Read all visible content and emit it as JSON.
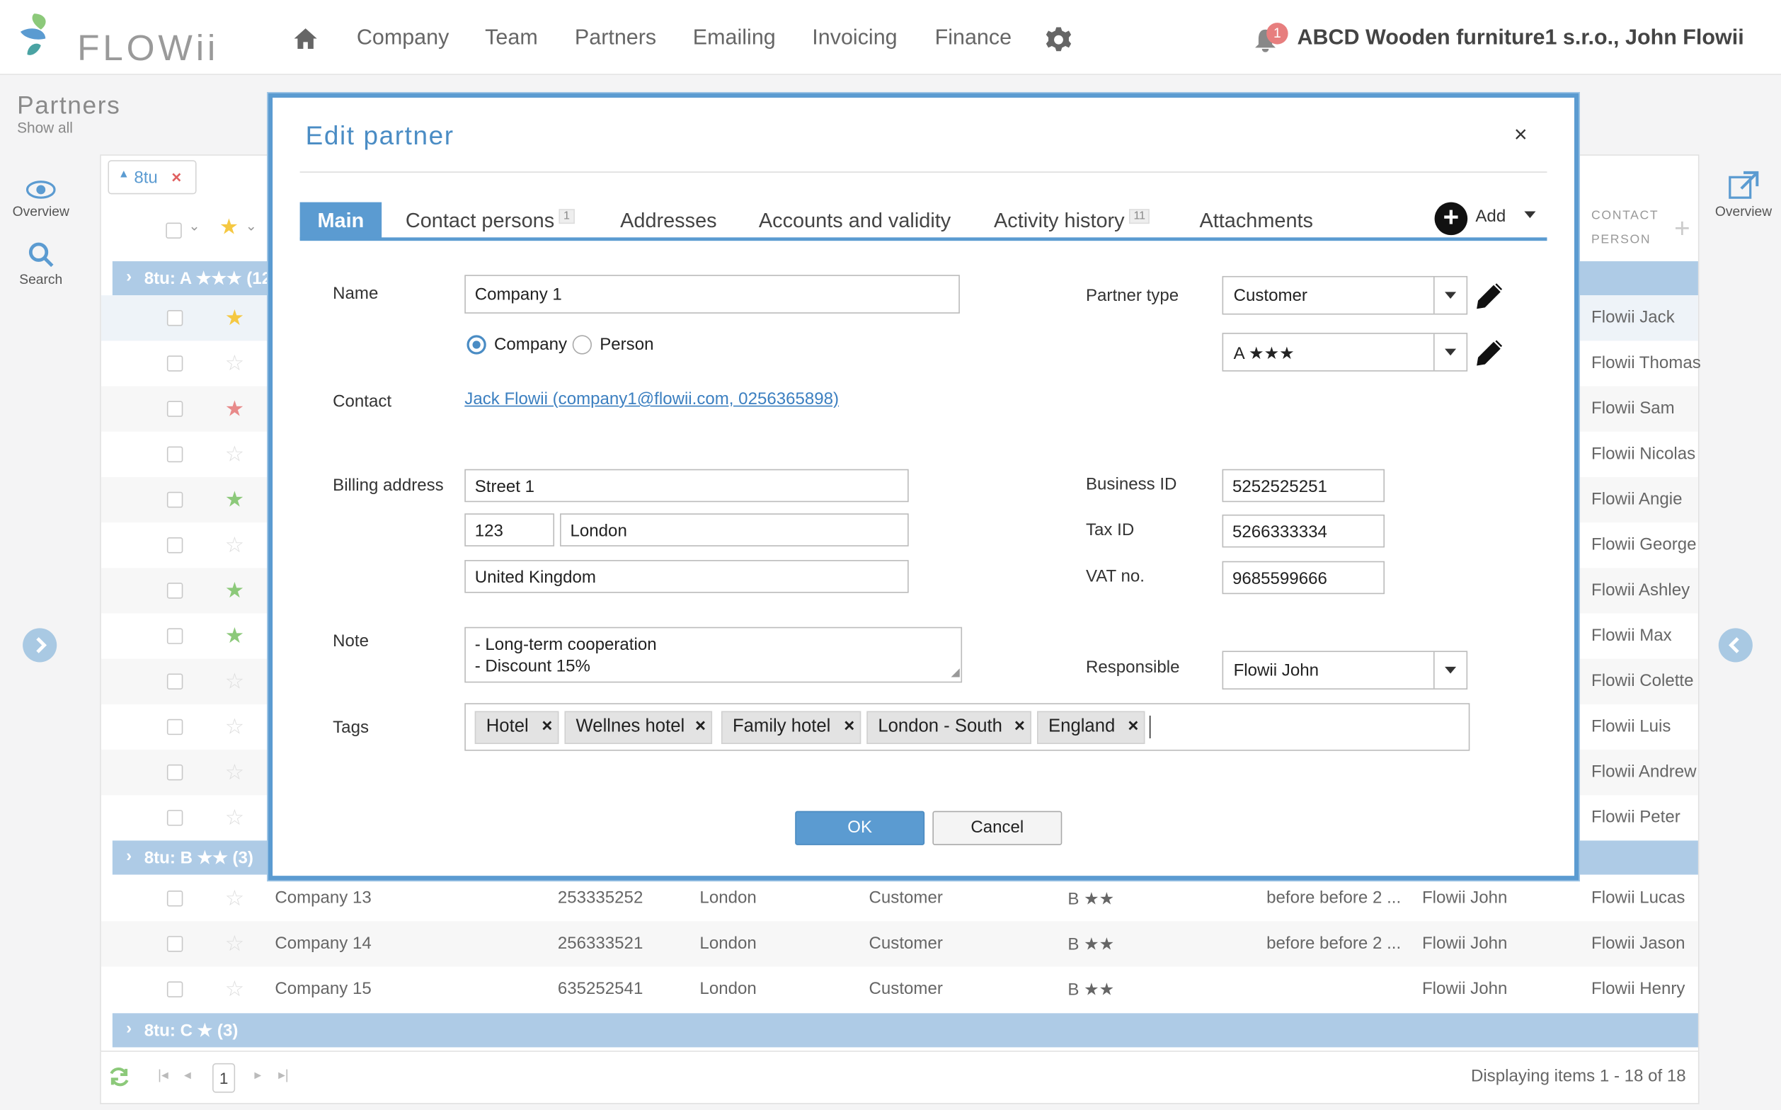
{
  "header": {
    "logo": "FLOWii",
    "nav": [
      "Company",
      "Team",
      "Partners",
      "Emailing",
      "Invoicing",
      "Finance"
    ],
    "notifications": "1",
    "user": "ABCD Wooden furniture1 s.r.o., John Flowii"
  },
  "page": {
    "title": "Partners",
    "subtitle": "Show all"
  },
  "leftbar": {
    "overview": "Overview",
    "search": "Search"
  },
  "rightbar": {
    "overview": "Overview"
  },
  "filter": {
    "chip": "8tu"
  },
  "grid": {
    "contact_header_1": "CONTACT",
    "contact_header_2": "PERSON",
    "group_a": "8tu: A ★★★ (12",
    "group_b": "8tu: B ★★ (3)",
    "group_c": "8tu: C ★ (3)",
    "rows_a": [
      {
        "contact": "Flowii Jack"
      },
      {
        "contact": "Flowii Thomas"
      },
      {
        "contact": "Flowii Sam"
      },
      {
        "contact": "Flowii Nicolas"
      },
      {
        "contact": "Flowii Angie"
      },
      {
        "contact": "Flowii George"
      },
      {
        "contact": "Flowii Ashley"
      },
      {
        "contact": "Flowii Max"
      },
      {
        "contact": "Flowii Colette"
      },
      {
        "contact": "Flowii Luis"
      },
      {
        "contact": "Flowii Andrew"
      },
      {
        "contact": "Flowii Peter"
      }
    ],
    "rows_b": [
      {
        "name": "Company 13",
        "id": "253335252",
        "city": "London",
        "type": "Customer",
        "rating": "B ★★",
        "note": "before before 2 ...",
        "resp": "Flowii John",
        "contact": "Flowii Lucas"
      },
      {
        "name": "Company 14",
        "id": "256333521",
        "city": "London",
        "type": "Customer",
        "rating": "B ★★",
        "note": "before before 2 ...",
        "resp": "Flowii John",
        "contact": "Flowii Jason"
      },
      {
        "name": "Company 15",
        "id": "635252541",
        "city": "London",
        "type": "Customer",
        "rating": "B ★★",
        "note": "",
        "resp": "Flowii John",
        "contact": "Flowii Henry"
      }
    ],
    "page_number": "1",
    "status": "Displaying items 1 - 18 of 18"
  },
  "modal": {
    "title": "Edit partner",
    "close": "×",
    "tabs": {
      "main": "Main",
      "contacts": "Contact persons",
      "contacts_badge": "1",
      "addresses": "Addresses",
      "accounts": "Accounts and validity",
      "activity": "Activity history",
      "activity_badge": "11",
      "attachments": "Attachments",
      "add": "Add"
    },
    "labels": {
      "name": "Name",
      "contact": "Contact",
      "billing": "Billing address",
      "note": "Note",
      "tags": "Tags",
      "partner_type": "Partner type",
      "business_id": "Business ID",
      "tax_id": "Tax ID",
      "vat": "VAT no.",
      "responsible": "Responsible"
    },
    "values": {
      "name": "Company 1",
      "radio_company": "Company",
      "radio_person": "Person",
      "contact_link": "Jack Flowii (company1@flowii.com, 0256365898)",
      "street": "Street 1",
      "zip": "123",
      "city": "London",
      "country": "United Kingdom",
      "note_line1": "- Long-term cooperation",
      "note_line2": "- Discount 15%",
      "partner_type": "Customer",
      "rating": "A ★★★",
      "business_id": "5252525251",
      "tax_id": "5266333334",
      "vat": "9685599666",
      "responsible": "Flowii John"
    },
    "tags": [
      "Hotel",
      "Wellnes hotel",
      "Family hotel",
      "London - South",
      "England"
    ],
    "ok": "OK",
    "cancel": "Cancel"
  },
  "colors": {
    "accent": "#5b9bd1",
    "group": "#aecbe6",
    "star_yellow": "#f5c842",
    "star_red": "#e88a8a",
    "star_green": "#8cc97a"
  }
}
